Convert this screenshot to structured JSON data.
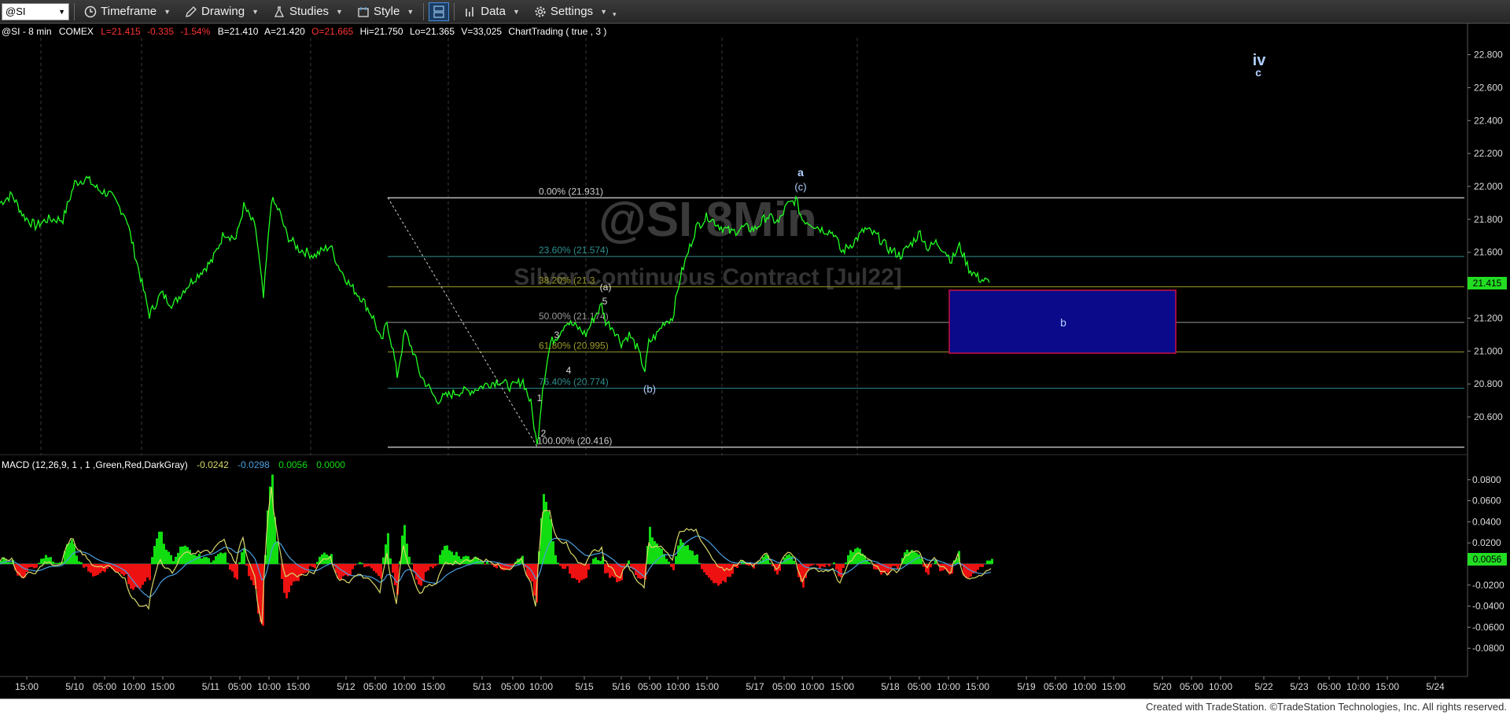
{
  "toolbar": {
    "symbol": "@SI",
    "timeframe_label": "Timeframe",
    "drawing_label": "Drawing",
    "studies_label": "Studies",
    "style_label": "Style",
    "data_label": "Data",
    "settings_label": "Settings"
  },
  "header": {
    "symbol": "@SI - 8 min",
    "exchange": "COMEX",
    "last": "L=21.415",
    "change": "-0.335",
    "change_pct": "-1.54%",
    "bid": "B=21.410",
    "ask": "A=21.420",
    "open": "O=21.665",
    "high": "Hi=21.750",
    "low": "Lo=21.365",
    "volume": "V=33,025",
    "charttrading": "ChartTrading ( true , 3 )"
  },
  "watermark": {
    "title": "@SI 8Min",
    "subtitle": "Silver Continuous Contract [Jul22]"
  },
  "macd_header": {
    "label": "MACD (12,26,9, 1 , 1 ,Green,Red,DarkGray)",
    "macd": "-0.0242",
    "signal": "-0.0298",
    "hist": "0.0056",
    "zero": "0.0000"
  },
  "fib_labels": [
    "0.00% (21.931)",
    "23.60% (21.574)",
    "38.20% (21.3",
    "50.00% (21.174)",
    "61.80% (20.995)",
    "76.40% (20.774)",
    "100.00% (20.416)"
  ],
  "wave_labels": {
    "iv": "iv",
    "c_top": "c",
    "a": "a",
    "c_paren": "(c)",
    "a_paren": "(a)",
    "b_paren": "(b)",
    "b": "b",
    "n1": "1",
    "n2": "2",
    "n3": "3",
    "n4": "4",
    "n5": "5"
  },
  "price_axis": [
    "22.800",
    "22.600",
    "22.400",
    "22.200",
    "22.000",
    "21.800",
    "21.600",
    "21.200",
    "21.000",
    "20.800",
    "20.600"
  ],
  "price_tag": "21.415",
  "macd_axis": [
    "0.0800",
    "0.0600",
    "0.0400",
    "0.0200",
    "-0.0200",
    "-0.0400",
    "-0.0600",
    "-0.0800"
  ],
  "macd_tag": "0.0056",
  "time_axis": [
    "15:00",
    "5/10",
    "05:00",
    "10:00",
    "15:00",
    "5/11",
    "05:00",
    "10:00",
    "15:00",
    "5/12",
    "05:00",
    "10:00",
    "15:00",
    "5/13",
    "05:00",
    "10:00",
    "5/15",
    "5/16",
    "05:00",
    "10:00",
    "15:00",
    "5/17",
    "05:00",
    "10:00",
    "15:00",
    "5/18",
    "05:00",
    "10:00",
    "15:00",
    "5/19",
    "05:00",
    "10:00",
    "15:00",
    "5/20",
    "05:00",
    "10:00",
    "5/22",
    "5/23",
    "05:00",
    "10:00",
    "15:00",
    "5/24"
  ],
  "footer": "Created with TradeStation. ©TradeStation Technologies, Inc. All rights reserved.",
  "chart_data": {
    "type": "line",
    "price_ylim": [
      20.4,
      22.9
    ],
    "price_series": [
      [
        0,
        21.9
      ],
      [
        15,
        21.95
      ],
      [
        30,
        21.82
      ],
      [
        45,
        21.76
      ],
      [
        60,
        21.8
      ],
      [
        80,
        21.8
      ],
      [
        95,
        22.02
      ],
      [
        110,
        22.05
      ],
      [
        125,
        21.98
      ],
      [
        140,
        21.95
      ],
      [
        160,
        21.82
      ],
      [
        175,
        21.52
      ],
      [
        190,
        21.22
      ],
      [
        205,
        21.35
      ],
      [
        220,
        21.28
      ],
      [
        235,
        21.38
      ],
      [
        255,
        21.48
      ],
      [
        270,
        21.55
      ],
      [
        285,
        21.72
      ],
      [
        300,
        21.68
      ],
      [
        310,
        21.88
      ],
      [
        325,
        21.75
      ],
      [
        335,
        21.32
      ],
      [
        345,
        21.92
      ],
      [
        355,
        21.85
      ],
      [
        365,
        21.7
      ],
      [
        380,
        21.62
      ],
      [
        400,
        21.58
      ],
      [
        420,
        21.64
      ],
      [
        430,
        21.52
      ],
      [
        445,
        21.4
      ],
      [
        460,
        21.32
      ],
      [
        475,
        21.2
      ],
      [
        485,
        21.05
      ],
      [
        492,
        21.18
      ],
      [
        500,
        21.0
      ],
      [
        505,
        20.85
      ],
      [
        515,
        21.12
      ],
      [
        525,
        21.0
      ],
      [
        535,
        20.85
      ],
      [
        545,
        20.78
      ],
      [
        555,
        20.7
      ],
      [
        565,
        20.72
      ],
      [
        580,
        20.75
      ],
      [
        600,
        20.76
      ],
      [
        620,
        20.8
      ],
      [
        635,
        20.82
      ],
      [
        650,
        20.78
      ],
      [
        665,
        20.82
      ],
      [
        675,
        20.68
      ],
      [
        683,
        20.42
      ],
      [
        690,
        20.78
      ],
      [
        700,
        21.05
      ],
      [
        710,
        21.1
      ],
      [
        720,
        21.18
      ],
      [
        735,
        21.14
      ],
      [
        745,
        21.1
      ],
      [
        755,
        21.2
      ],
      [
        765,
        21.28
      ],
      [
        770,
        21.18
      ],
      [
        780,
        21.14
      ],
      [
        790,
        21.05
      ],
      [
        800,
        21.1
      ],
      [
        810,
        21.02
      ],
      [
        820,
        20.88
      ],
      [
        825,
        21.05
      ],
      [
        835,
        21.1
      ],
      [
        845,
        21.18
      ],
      [
        855,
        21.2
      ],
      [
        865,
        21.45
      ],
      [
        875,
        21.6
      ],
      [
        885,
        21.75
      ],
      [
        900,
        21.82
      ],
      [
        915,
        21.76
      ],
      [
        930,
        21.72
      ],
      [
        945,
        21.75
      ],
      [
        960,
        21.74
      ],
      [
        975,
        21.82
      ],
      [
        990,
        21.78
      ],
      [
        1000,
        21.88
      ],
      [
        1012,
        21.92
      ],
      [
        1020,
        21.8
      ],
      [
        1030,
        21.78
      ],
      [
        1045,
        21.74
      ],
      [
        1060,
        21.72
      ],
      [
        1070,
        21.6
      ],
      [
        1085,
        21.66
      ],
      [
        1100,
        21.74
      ],
      [
        1115,
        21.7
      ],
      [
        1130,
        21.62
      ],
      [
        1145,
        21.58
      ],
      [
        1160,
        21.66
      ],
      [
        1170,
        21.72
      ],
      [
        1180,
        21.62
      ],
      [
        1190,
        21.66
      ],
      [
        1200,
        21.62
      ],
      [
        1210,
        21.55
      ],
      [
        1220,
        21.64
      ],
      [
        1232,
        21.5
      ],
      [
        1245,
        21.44
      ],
      [
        1258,
        21.415
      ]
    ],
    "fib_levels": [
      21.931,
      21.574,
      21.39,
      21.174,
      20.995,
      20.774,
      20.416
    ],
    "target_box": {
      "x_range": [
        "5/18 10:00",
        "5/20"
      ],
      "y_range": [
        20.98,
        21.38
      ],
      "label": "b"
    },
    "macd_ylim": [
      -0.09,
      0.09
    ]
  },
  "colors": {
    "price": "#22ff22",
    "macd_line": "#d9d96a",
    "signal_line": "#4a9fe0",
    "hist_pos": "#11dd11",
    "hist_neg": "#ee1111",
    "box_fill": "#0a0a8a",
    "box_border": "#cc1144",
    "label_blue": "#b0d0ff"
  }
}
